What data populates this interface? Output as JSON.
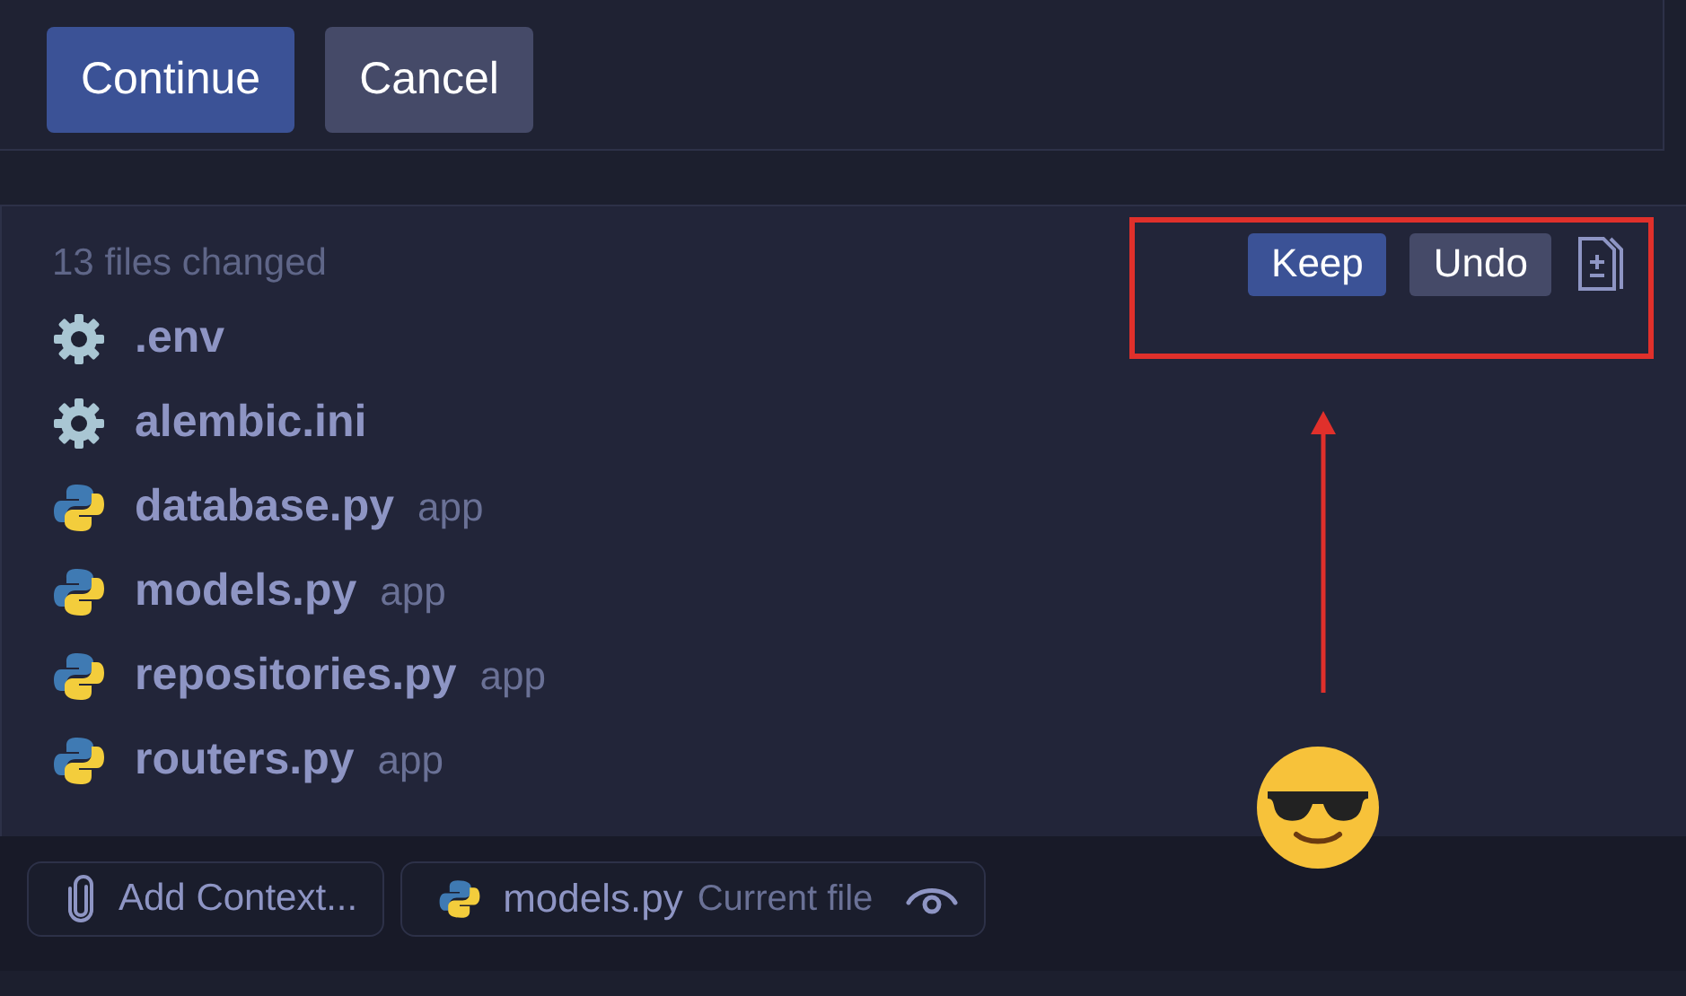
{
  "dialog": {
    "buttons": [
      {
        "label": "Continue",
        "kind": "primary"
      },
      {
        "label": "Cancel",
        "kind": "secondary"
      }
    ]
  },
  "changes": {
    "summary": "13 files changed",
    "actions": [
      {
        "label": "Keep",
        "kind": "primary"
      },
      {
        "label": "Undo",
        "kind": "secondary"
      }
    ],
    "files": [
      {
        "name": ".env",
        "kind": "config"
      },
      {
        "name": "alembic.ini",
        "kind": "config"
      },
      {
        "name": "database.py",
        "kind": "python",
        "folder": "app"
      },
      {
        "name": "models.py",
        "kind": "python",
        "folder": "app"
      },
      {
        "name": "repositories.py",
        "kind": "python",
        "folder": "app"
      },
      {
        "name": "routers.py",
        "kind": "python",
        "folder": "app"
      }
    ]
  },
  "context_bar": {
    "add_label": "Add Context...",
    "current": {
      "name": "models.py",
      "note": "Current file",
      "kind": "python"
    }
  }
}
